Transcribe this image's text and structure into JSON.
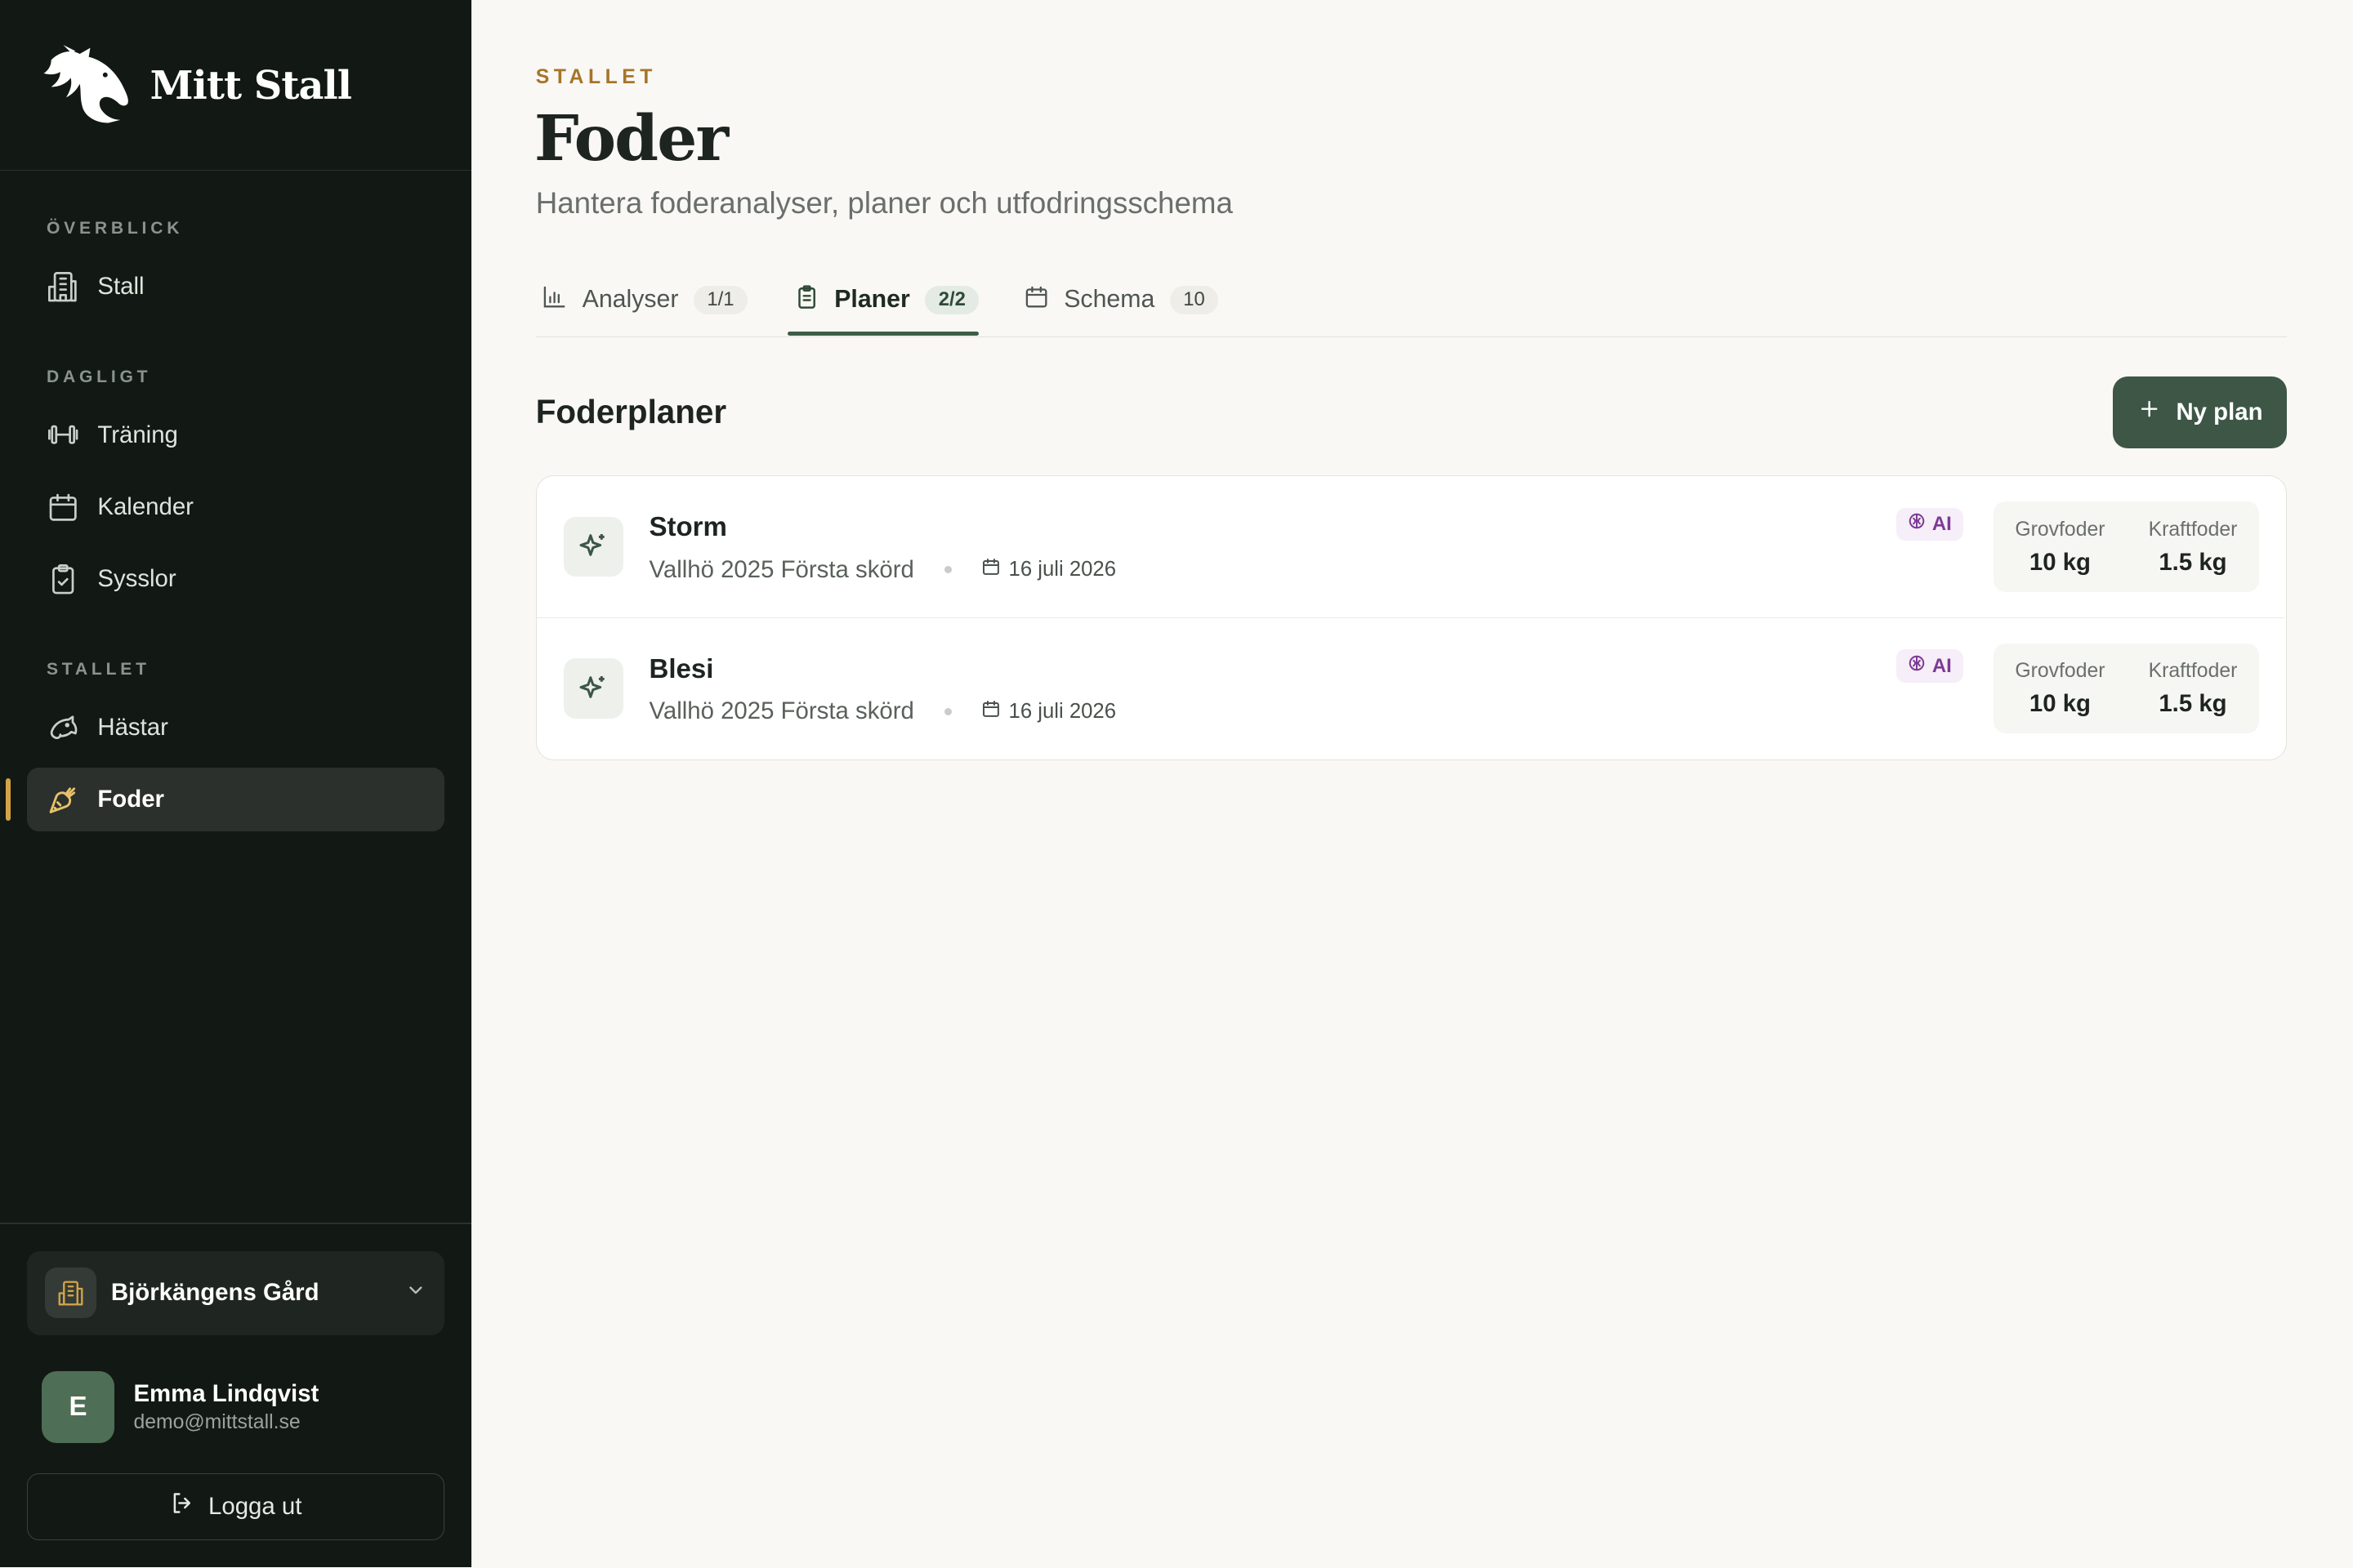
{
  "app": {
    "name": "Mitt Stall"
  },
  "sidebar": {
    "sections": [
      {
        "label": "ÖVERBLICK",
        "items": [
          {
            "label": "Stall",
            "icon": "building-icon"
          }
        ]
      },
      {
        "label": "DAGLIGT",
        "items": [
          {
            "label": "Träning",
            "icon": "dumbbell-icon"
          },
          {
            "label": "Kalender",
            "icon": "calendar-icon"
          },
          {
            "label": "Sysslor",
            "icon": "clipboard-check-icon"
          }
        ]
      },
      {
        "label": "STALLET",
        "items": [
          {
            "label": "Hästar",
            "icon": "horse-icon"
          },
          {
            "label": "Foder",
            "icon": "carrot-icon",
            "active": true
          }
        ]
      }
    ],
    "farm": {
      "name": "Björkängens Gård"
    },
    "user": {
      "initial": "E",
      "name": "Emma Lindqvist",
      "email": "demo@mittstall.se"
    },
    "logout_label": "Logga ut"
  },
  "page": {
    "eyebrow": "STALLET",
    "title": "Foder",
    "subtitle": "Hantera foderanalyser, planer och utfodringsschema"
  },
  "tabs": [
    {
      "label": "Analyser",
      "count": "1/1",
      "icon": "bar-chart-icon"
    },
    {
      "label": "Planer",
      "count": "2/2",
      "icon": "clipboard-icon",
      "active": true
    },
    {
      "label": "Schema",
      "count": "10",
      "icon": "calendar-icon"
    }
  ],
  "plans_section": {
    "title": "Foderplaner",
    "new_button_label": "Ny plan",
    "plans": [
      {
        "name": "Storm",
        "hay": "Vallhö 2025 Första skörd",
        "date": "16 juli 2026",
        "ai_label": "AI",
        "stats": [
          {
            "label": "Grovfoder",
            "value": "10 kg"
          },
          {
            "label": "Kraftfoder",
            "value": "1.5 kg"
          }
        ]
      },
      {
        "name": "Blesi",
        "hay": "Vallhö 2025 Första skörd",
        "date": "16 juli 2026",
        "ai_label": "AI",
        "stats": [
          {
            "label": "Grovfoder",
            "value": "10 kg"
          },
          {
            "label": "Kraftfoder",
            "value": "1.5 kg"
          }
        ]
      }
    ]
  },
  "colors": {
    "sidebar_bg": "#121914",
    "accent_green": "#3d5646",
    "accent_gold": "#d4a347",
    "eyebrow": "#a6752a",
    "ai_purple": "#7c3a94"
  }
}
